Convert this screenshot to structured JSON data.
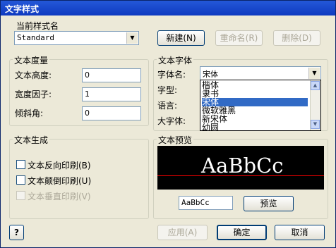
{
  "window": {
    "title": "文字样式"
  },
  "current_style": {
    "label": "当前样式名",
    "value": "Standard"
  },
  "buttons": {
    "new": "新建(N)",
    "rename": "重命名(R)",
    "delete": "删除(D)",
    "preview": "预览",
    "apply": "应用(A)",
    "ok": "确定",
    "cancel": "取消",
    "help": "?"
  },
  "text_metrics": {
    "title": "文本度量",
    "height_label": "文本高度:",
    "height_value": "0",
    "width_label": "宽度因子:",
    "width_value": "1",
    "oblique_label": "倾斜角:",
    "oblique_value": "0"
  },
  "text_font": {
    "title": "文本字体",
    "font_name_label": "字体名:",
    "font_name_value": "宋体",
    "style_label": "字型:",
    "language_label": "语言:",
    "bigfont_label": "大字体:",
    "font_options": [
      "楷体",
      "隶书",
      "宋体",
      "微软雅黑",
      "新宋体",
      "幼圆"
    ],
    "selected_option": "宋体"
  },
  "text_generation": {
    "title": "文本生成",
    "backwards": "文本反向印刷(B)",
    "upside_down": "文本颠倒印刷(U)",
    "vertical": "文本垂直印刷(V)"
  },
  "text_preview": {
    "title": "文本预览",
    "sample": "AaBbCc",
    "input_value": "AaBbCc"
  },
  "colors": {
    "preview_bg": "#000000",
    "preview_text": "#ffffff",
    "preview_line": "#ff0000",
    "selection": "#316ac5"
  }
}
